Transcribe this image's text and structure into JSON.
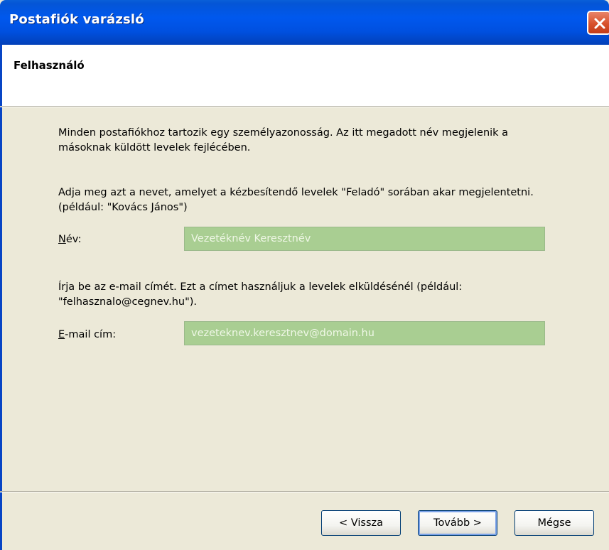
{
  "window": {
    "title": "Postafiók varázsló"
  },
  "header": {
    "heading": "Felhasználó"
  },
  "content": {
    "intro_paragraph": "Minden postafiókhoz tartozik egy személyazonosság. Az itt megadott név megjelenik a másoknak küldött levelek fejlécében.",
    "name_instructions": "Adja meg azt a nevet, amelyet a kézbesítendő levelek \"Feladó\" sorában akar megjelentetni. (például: \"Kovács János\")",
    "name_label_accel": "N",
    "name_label_rest": "év:",
    "name_value": "Vezetéknév Keresztnév",
    "email_instructions": "Írja be az e-mail címét. Ezt a címet használjuk a levelek elküldésénél (például: \"felhasznalo@cegnev.hu\").",
    "email_label_accel": "E",
    "email_label_rest": "-mail cím:",
    "email_value": "vezeteknev.keresztnev@domain.hu"
  },
  "buttons": {
    "back": "< Vissza",
    "next": "Tovább >",
    "cancel": "Mégse"
  },
  "colors": {
    "titlebar": "#0058ee",
    "field_fill": "#a9ce92",
    "close_button": "#d8512c"
  },
  "icons": {
    "close": "close-icon"
  }
}
